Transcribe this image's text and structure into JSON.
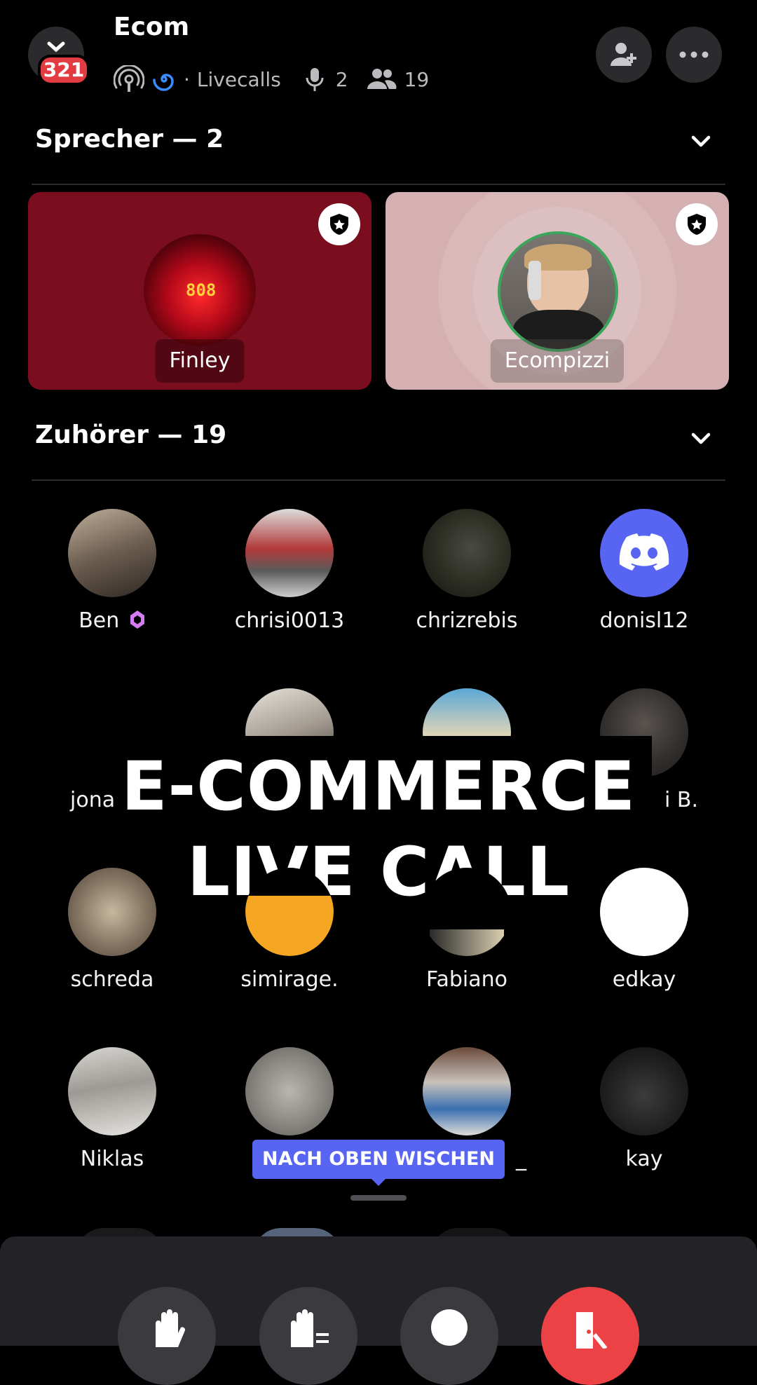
{
  "header": {
    "badge_count": "321",
    "title": "Ecom",
    "dot_separator": "·",
    "channel": "Livecalls",
    "speakers_count": "2",
    "members_count": "19"
  },
  "speakers_section": {
    "label": "Sprecher — 2",
    "speakers": [
      {
        "name": "Finley",
        "card_color": "#7a0d1e"
      },
      {
        "name": "Ecompizzi",
        "card_color": "#d5b0b2"
      }
    ]
  },
  "listeners_section": {
    "label": "Zuhörer — 19",
    "listeners": [
      {
        "name": "Ben"
      },
      {
        "name": "chrisi0013"
      },
      {
        "name": "chrizrebis"
      },
      {
        "name": "donisl12"
      },
      {
        "name": "jona"
      },
      {
        "name": ""
      },
      {
        "name": ""
      },
      {
        "name": "i B."
      },
      {
        "name": "schreda"
      },
      {
        "name": "simirage."
      },
      {
        "name": "Fabiano"
      },
      {
        "name": "edkay"
      },
      {
        "name": "Niklas"
      },
      {
        "name": ""
      },
      {
        "name": "_"
      },
      {
        "name": "kay"
      }
    ]
  },
  "overlay": {
    "line1": "E-COMMERCE",
    "line2": "LIVE CALL"
  },
  "swipe_hint": "NACH OBEN WISCHEN",
  "colors": {
    "accent": "#5865f2",
    "danger": "#ed4245",
    "online": "#3ba55c"
  },
  "icons": [
    "close-icon",
    "stage-icon",
    "swirl-icon",
    "mic-icon",
    "people-icon",
    "add-user-icon",
    "more-icon",
    "chevron-down-icon",
    "moderator-shield-icon",
    "nitro-badge-icon",
    "discord-logo-icon",
    "raise-hand-icon",
    "hand-list-icon",
    "leave-icon"
  ]
}
